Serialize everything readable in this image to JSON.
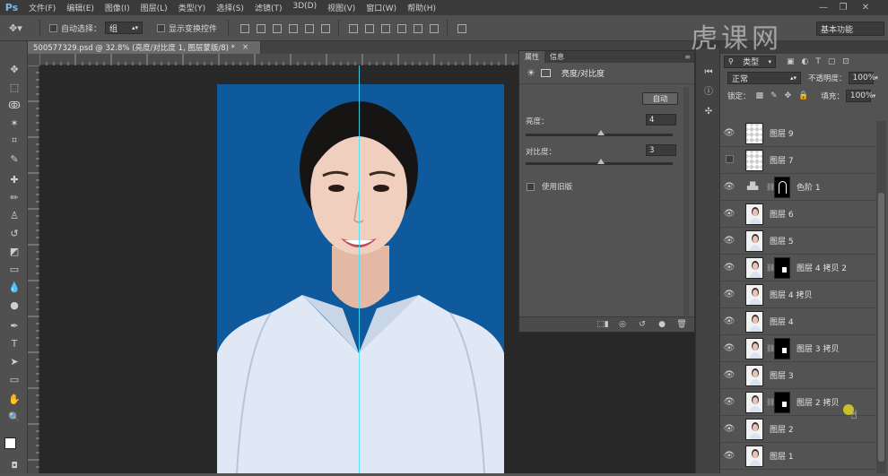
{
  "app": {
    "logo": "Ps"
  },
  "menu": [
    "文件(F)",
    "编辑(E)",
    "图像(I)",
    "图层(L)",
    "类型(Y)",
    "选择(S)",
    "滤镜(T)",
    "3D(D)",
    "视图(V)",
    "窗口(W)",
    "帮助(H)"
  ],
  "options": {
    "auto_select_label": "自动选择：",
    "auto_select_value": "组",
    "show_transform_label": "显示变换控件",
    "workspace": "基本功能"
  },
  "document": {
    "tab_title": "500577329.psd @ 32.8% (亮度/对比度 1, 图层蒙版/8) *",
    "close": "×"
  },
  "watermark": "虎课网",
  "properties": {
    "tabs": [
      "属性",
      "信息"
    ],
    "title": "亮度/对比度",
    "auto_button": "自动",
    "brightness_label": "亮度：",
    "brightness_value": "4",
    "brightness_level": 0.51,
    "contrast_label": "对比度：",
    "contrast_value": "3",
    "contrast_level": 0.51,
    "legacy_label": "使用旧版"
  },
  "layers_panel": {
    "filter_kind": "类型",
    "blend_mode": "正常",
    "opacity_label": "不透明度：",
    "opacity_value": "100%",
    "lock_label": "锁定：",
    "fill_label": "填充：",
    "fill_value": "100%",
    "layers": [
      {
        "name": "图层 9",
        "visible": true,
        "thumb": "checker",
        "mask": false
      },
      {
        "name": "图层 7",
        "visible": false,
        "thumb": "checker",
        "mask": false
      },
      {
        "name": "色阶 1",
        "visible": true,
        "thumb": "levels",
        "mask": true
      },
      {
        "name": "图层 6",
        "visible": true,
        "thumb": "photo",
        "mask": false
      },
      {
        "name": "图层 5",
        "visible": true,
        "thumb": "photo",
        "mask": false
      },
      {
        "name": "图层 4 拷贝 2",
        "visible": true,
        "thumb": "photo",
        "mask": true
      },
      {
        "name": "图层 4 拷贝",
        "visible": true,
        "thumb": "photo",
        "mask": false
      },
      {
        "name": "图层 4",
        "visible": true,
        "thumb": "photo",
        "mask": false
      },
      {
        "name": "图层 3 拷贝",
        "visible": true,
        "thumb": "photo",
        "mask": true
      },
      {
        "name": "图层 3",
        "visible": true,
        "thumb": "photo",
        "mask": false
      },
      {
        "name": "图层 2 拷贝",
        "visible": true,
        "thumb": "photo",
        "mask": true
      },
      {
        "name": "图层 2",
        "visible": true,
        "thumb": "photo",
        "mask": false
      },
      {
        "name": "图层 1",
        "visible": true,
        "thumb": "photo",
        "mask": false
      }
    ]
  },
  "colors": {
    "photo_bg": "#0f5a9c",
    "guide": "#3ee3ff",
    "ui_bg": "#535353"
  }
}
